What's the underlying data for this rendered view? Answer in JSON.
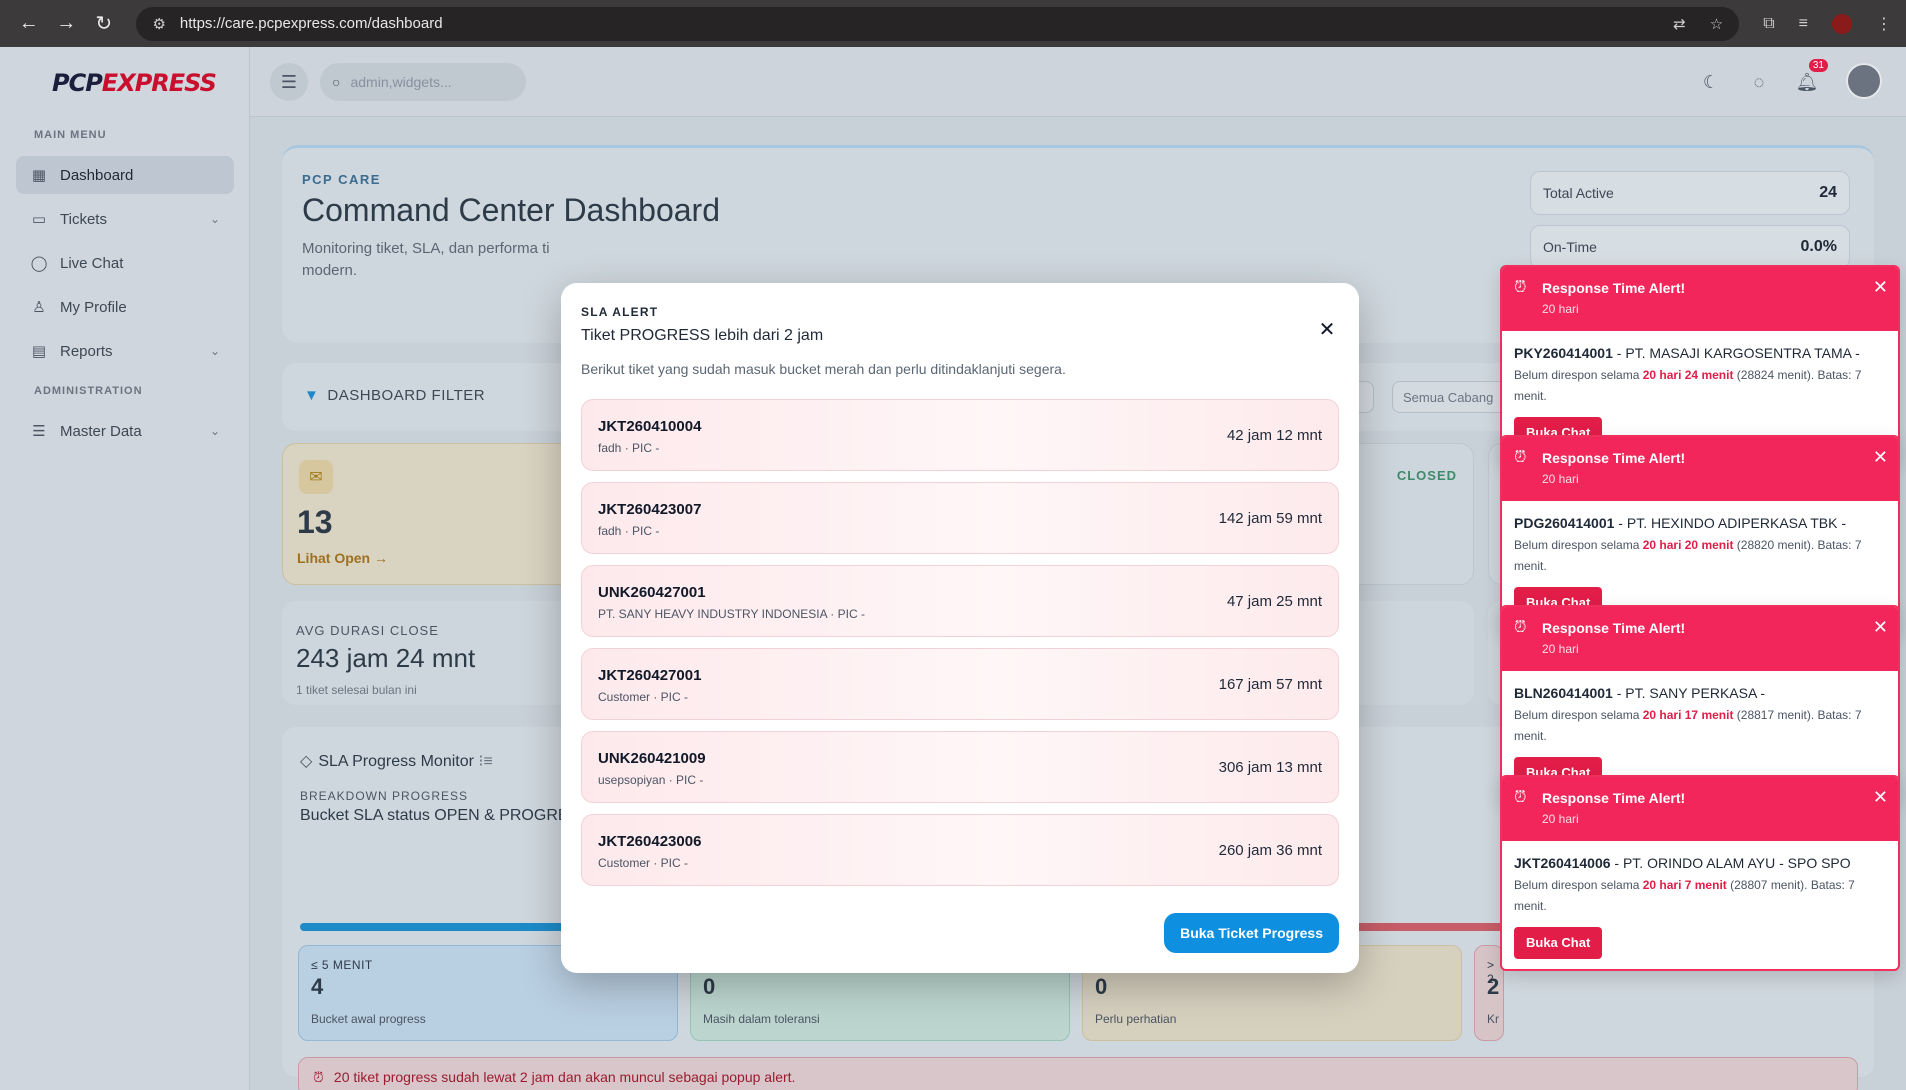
{
  "browser": {
    "url": "https://care.pcpexpress.com/dashboard",
    "nav": [
      "←",
      "→",
      "↻"
    ]
  },
  "logo": {
    "pcp": "PCP",
    "express": "EXPRESS"
  },
  "sidebar": {
    "section_main": "MAIN MENU",
    "section_admin": "ADMINISTRATION",
    "items": [
      {
        "label": "Dashboard",
        "icon": "grid-icon"
      },
      {
        "label": "Tickets",
        "icon": "ticket-icon"
      },
      {
        "label": "Live Chat",
        "icon": "chat-icon"
      },
      {
        "label": "My Profile",
        "icon": "user-icon"
      },
      {
        "label": "Reports",
        "icon": "report-icon"
      },
      {
        "label": "Master Data",
        "icon": "database-icon"
      }
    ]
  },
  "topbar": {
    "search_placeholder": "admin,widgets...",
    "notification_count": "31"
  },
  "hero": {
    "eyebrow": "PCP CARE",
    "title": "Command Center Dashboard",
    "description": "Monitoring tiket, SLA, dan performa ti modern.",
    "stats": [
      {
        "label": "Total Active",
        "value": "24"
      },
      {
        "label": "On-Time",
        "value": "0.0%"
      }
    ]
  },
  "filter": {
    "label": "DASHBOARD FILTER",
    "branch": "Semua Cabang"
  },
  "open_card": {
    "count": "13",
    "link": "Lihat Open"
  },
  "closed_card": {
    "label": "CLOSED"
  },
  "avg_card": {
    "label": "AVG DURASI CLOSE",
    "value": "243 jam 24 mnt",
    "sub": "1 tiket selesai bulan ini"
  },
  "sla_panel": {
    "title": "SLA Progress Monitor",
    "sub_label": "BREAKDOWN PROGRESS",
    "sub_title": "Bucket SLA status OPEN & PROGRE",
    "buckets": [
      {
        "label": "≤ 5 MENIT",
        "count": "4",
        "desc": "Bucket awal progress",
        "color": "#b9cfe2"
      },
      {
        "label": "",
        "count": "0",
        "desc": "Masih dalam toleransi",
        "color": "#bcd6cf"
      },
      {
        "label": "",
        "count": "0",
        "desc": "Perlu perhatian",
        "color": "#d6d0bf"
      },
      {
        "label": "> 2",
        "count": "2",
        "desc": "Kr",
        "color": "#d6c4c7"
      }
    ],
    "warning": "20 tiket progress sudah lewat 2 jam dan akan muncul sebagai popup alert."
  },
  "modal": {
    "eyebrow": "SLA ALERT",
    "title": "Tiket PROGRESS lebih dari 2 jam",
    "description": "Berikut tiket yang sudah masuk bucket merah dan perlu ditindaklanjuti segera.",
    "tickets": [
      {
        "code": "JKT260410004",
        "meta": "fadh · PIC -",
        "duration": "42 jam 12 mnt"
      },
      {
        "code": "JKT260423007",
        "meta": "fadh · PIC -",
        "duration": "142 jam 59 mnt"
      },
      {
        "code": "UNK260427001",
        "meta": "PT. SANY HEAVY INDUSTRY INDONESIA · PIC -",
        "duration": "47 jam 25 mnt"
      },
      {
        "code": "JKT260427001",
        "meta": "Customer · PIC -",
        "duration": "167 jam 57 mnt"
      },
      {
        "code": "UNK260421009",
        "meta": "usepsopiyan · PIC -",
        "duration": "306 jam 13 mnt"
      },
      {
        "code": "JKT260423006",
        "meta": "Customer · PIC -",
        "duration": "260 jam 36 mnt"
      }
    ],
    "button": "Buka Ticket Progress"
  },
  "toasts": [
    {
      "title": "Response Time Alert!",
      "time": "20 hari",
      "code": "PKY260414001",
      "company": " - PT. MASAJI KARGOSENTRA TAMA -",
      "desc_pre": "Belum direspon selama ",
      "desc_bold": "20 hari 24 menit",
      "desc_post": " (28824 menit). Batas: 7 menit.",
      "button": "Buka Chat"
    },
    {
      "title": "Response Time Alert!",
      "time": "20 hari",
      "code": "PDG260414001",
      "company": " - PT. HEXINDO ADIPERKASA TBK -",
      "desc_pre": "Belum direspon selama ",
      "desc_bold": "20 hari 20 menit",
      "desc_post": " (28820 menit). Batas: 7 menit.",
      "button": "Buka Chat"
    },
    {
      "title": "Response Time Alert!",
      "time": "20 hari",
      "code": "BLN260414001",
      "company": " - PT. SANY PERKASA -",
      "desc_pre": "Belum direspon selama ",
      "desc_bold": "20 hari 17 menit",
      "desc_post": " (28817 menit). Batas: 7 menit.",
      "button": "Buka Chat"
    },
    {
      "title": "Response Time Alert!",
      "time": "20 hari",
      "code": "JKT260414006",
      "company": " - PT. ORINDO ALAM AYU - SPO SPO",
      "desc_pre": "Belum direspon selama ",
      "desc_bold": "20 hari 7 menit",
      "desc_post": " (28807 menit). Batas: 7 menit.",
      "button": "Buka Chat"
    }
  ]
}
